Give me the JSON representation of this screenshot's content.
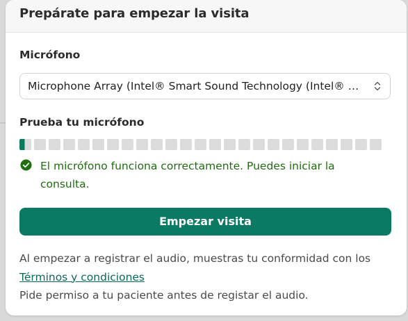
{
  "dialog": {
    "title": "Prepárate para empezar la visita"
  },
  "microphone": {
    "label": "Micrófono",
    "selected": "Microphone Array (Intel® Smart Sound Technology (Intel® Smart Sound Technology for Digital Microphones))"
  },
  "mic_test": {
    "label": "Prueba tu micrófono",
    "segments_total": 25,
    "level": 0.018,
    "active_color": "#0d7a5e",
    "inactive_color": "#dcdcdc"
  },
  "status": {
    "icon": "check-circle-icon",
    "text": "El micrófono funciona correctamente. Puedes iniciar la consulta.",
    "color": "#1f6e10"
  },
  "start_button": {
    "label": "Empezar visita",
    "color": "#0a7a62"
  },
  "footer": {
    "consent_prefix": "Al empezar a registrar el audio, muestras tu conformidad con los ",
    "terms_link": "Términos y condiciones",
    "permission_note": "Pide permiso a tu paciente antes de registar el audio."
  }
}
